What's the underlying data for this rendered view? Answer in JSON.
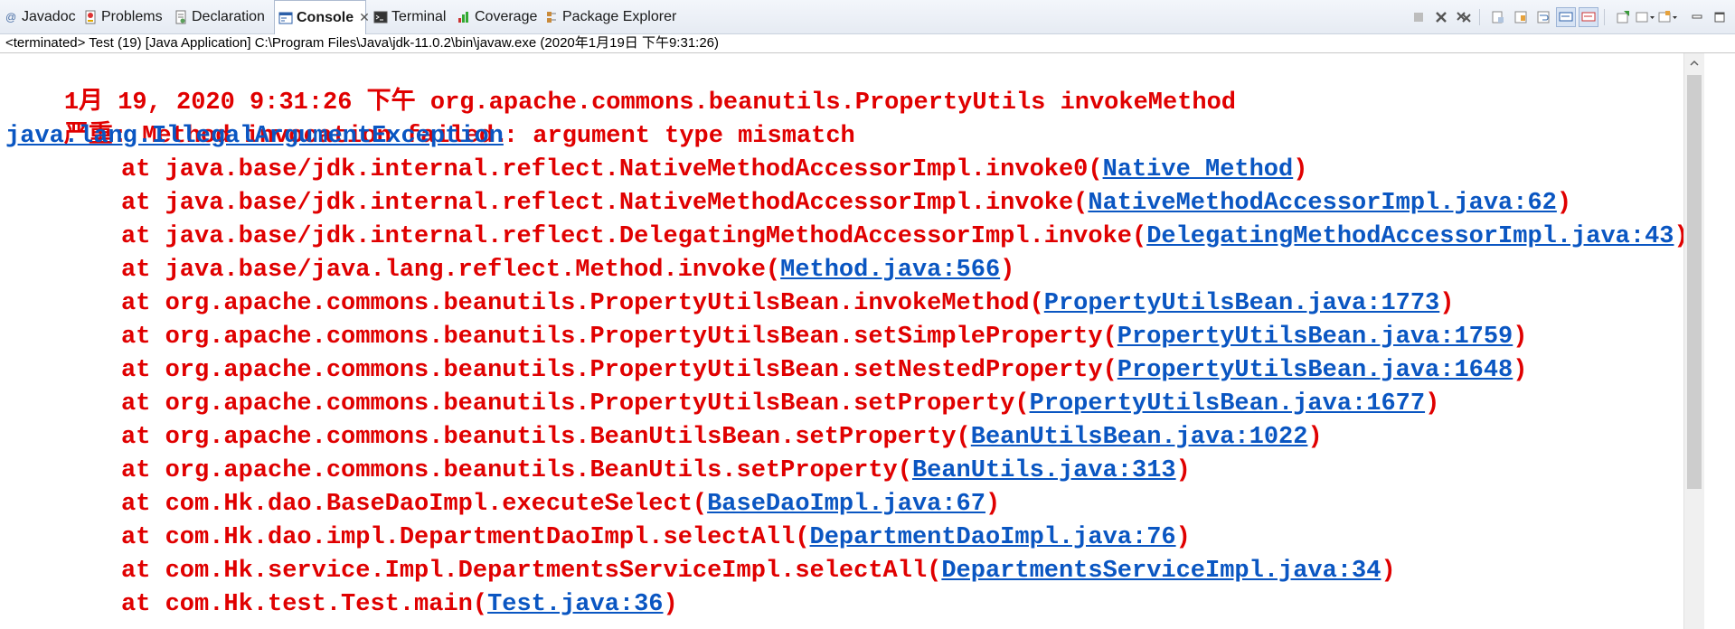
{
  "tabs": [
    {
      "label": "Javadoc",
      "icon": "at-sign-icon",
      "active": false
    },
    {
      "label": "Problems",
      "icon": "problems-icon",
      "active": false
    },
    {
      "label": "Declaration",
      "icon": "declaration-icon",
      "active": false
    },
    {
      "label": "Console",
      "icon": "console-icon",
      "active": true
    },
    {
      "label": "Terminal",
      "icon": "terminal-icon",
      "active": false
    },
    {
      "label": "Coverage",
      "icon": "coverage-icon",
      "active": false
    },
    {
      "label": "Package Explorer",
      "icon": "package-explorer-icon",
      "active": false
    }
  ],
  "console": {
    "header": "<terminated> Test (19) [Java Application] C:\\Program Files\\Java\\jdk-11.0.2\\bin\\javaw.exe (2020年1月19日 下午9:31:26)",
    "lines": [
      {
        "text": "1月 19, 2020 9:31:26 下午 org.apache.commons.beanutils.PropertyUtils invokeMethod"
      },
      {
        "text": "严重: Method invocation failed."
      },
      {
        "link": "java.lang.IllegalArgumentException",
        "after": ": argument type mismatch"
      },
      {
        "before": "at java.base/jdk.internal.reflect.NativeMethodAccessorImpl.invoke0(",
        "link": "Native Method",
        "after": ")"
      },
      {
        "before": "at java.base/jdk.internal.reflect.NativeMethodAccessorImpl.invoke(",
        "link": "NativeMethodAccessorImpl.java:62",
        "after": ")"
      },
      {
        "before": "at java.base/jdk.internal.reflect.DelegatingMethodAccessorImpl.invoke(",
        "link": "DelegatingMethodAccessorImpl.java:43",
        "after": ")"
      },
      {
        "before": "at java.base/java.lang.reflect.Method.invoke(",
        "link": "Method.java:566",
        "after": ")"
      },
      {
        "before": "at org.apache.commons.beanutils.PropertyUtilsBean.invokeMethod(",
        "link": "PropertyUtilsBean.java:1773",
        "after": ")"
      },
      {
        "before": "at org.apache.commons.beanutils.PropertyUtilsBean.setSimpleProperty(",
        "link": "PropertyUtilsBean.java:1759",
        "after": ")"
      },
      {
        "before": "at org.apache.commons.beanutils.PropertyUtilsBean.setNestedProperty(",
        "link": "PropertyUtilsBean.java:1648",
        "after": ")"
      },
      {
        "before": "at org.apache.commons.beanutils.PropertyUtilsBean.setProperty(",
        "link": "PropertyUtilsBean.java:1677",
        "after": ")"
      },
      {
        "before": "at org.apache.commons.beanutils.BeanUtilsBean.setProperty(",
        "link": "BeanUtilsBean.java:1022",
        "after": ")"
      },
      {
        "before": "at org.apache.commons.beanutils.BeanUtils.setProperty(",
        "link": "BeanUtils.java:313",
        "after": ")"
      },
      {
        "before": "at com.Hk.dao.BaseDaoImpl.executeSelect(",
        "link": "BaseDaoImpl.java:67",
        "after": ")"
      },
      {
        "before": "at com.Hk.dao.impl.DepartmentDaoImpl.selectAll(",
        "link": "DepartmentDaoImpl.java:76",
        "after": ")"
      },
      {
        "before": "at com.Hk.service.Impl.DepartmentsServiceImpl.selectAll(",
        "link": "DepartmentsServiceImpl.java:34",
        "after": ")"
      },
      {
        "before": "at com.Hk.test.Test.main(",
        "link": "Test.java:36",
        "after": ")"
      }
    ]
  },
  "toolbar_icons": [
    "terminate-icon",
    "remove-launch-icon",
    "remove-all-terminated-icon",
    "clear-console-icon",
    "scroll-lock-icon",
    "word-wrap-icon",
    "show-stdout-icon",
    "show-stderr-icon",
    "pin-console-icon",
    "display-console-icon",
    "open-console-icon",
    "minimize-icon",
    "maximize-icon"
  ],
  "colors": {
    "error_text": "#e00000",
    "link": "#0a56c2",
    "tabbar_bg": "#e6ebf3"
  }
}
